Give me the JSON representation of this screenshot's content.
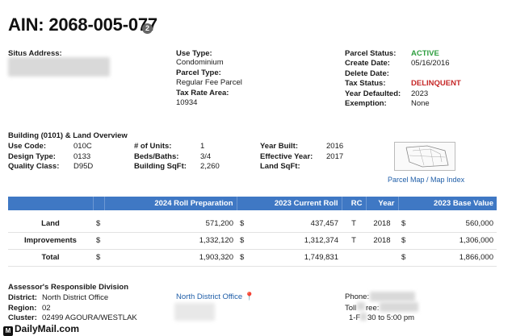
{
  "header": {
    "title": "AIN: 2068-005-077",
    "badge": "2"
  },
  "situs": {
    "label": "Situs Address:"
  },
  "use": {
    "use_type_label": "Use Type:",
    "use_type_value": "Condominium",
    "parcel_type_label": "Parcel Type:",
    "parcel_type_value": "Regular Fee Parcel",
    "tax_rate_label": "Tax Rate Area:",
    "tax_rate_value": "10934"
  },
  "status": {
    "parcel_status_label": "Parcel Status:",
    "parcel_status_value": "ACTIVE",
    "create_date_label": "Create Date:",
    "create_date_value": "05/16/2016",
    "delete_date_label": "Delete Date:",
    "delete_date_value": "",
    "tax_status_label": "Tax Status:",
    "tax_status_value": "DELINQUENT",
    "year_defaulted_label": "Year Defaulted:",
    "year_defaulted_value": "2023",
    "exemption_label": "Exemption:",
    "exemption_value": "None"
  },
  "building": {
    "heading": "Building (0101) & Land Overview",
    "use_code_label": "Use Code:",
    "use_code_value": "010C",
    "design_type_label": "Design Type:",
    "design_type_value": "0133",
    "quality_class_label": "Quality Class:",
    "quality_class_value": "D95D",
    "units_label": "# of Units:",
    "units_value": "1",
    "beds_baths_label": "Beds/Baths:",
    "beds_baths_value": "3/4",
    "building_sqft_label": "Building SqFt:",
    "building_sqft_value": "2,260",
    "year_built_label": "Year Built:",
    "year_built_value": "2016",
    "effective_year_label": "Effective Year:",
    "effective_year_value": "2017",
    "land_sqft_label": "Land SqFt:",
    "land_sqft_value": "",
    "parcel_map_link": "Parcel Map",
    "separator": " / ",
    "index_map_link": "Map Index"
  },
  "roll_table": {
    "headers": [
      "",
      "",
      "2024 Roll Preparation",
      "2023 Current Roll",
      "RC",
      "Year",
      "2023 Base Value"
    ],
    "rows": [
      {
        "label": "Land",
        "cur1": "$",
        "prep": "571,200",
        "cur2": "$",
        "current": "437,457",
        "rc": "T",
        "year": "2018",
        "cur3": "$",
        "base": "560,000"
      },
      {
        "label": "Improvements",
        "cur1": "$",
        "prep": "1,332,120",
        "cur2": "$",
        "current": "1,312,374",
        "rc": "T",
        "year": "2018",
        "cur3": "$",
        "base": "1,306,000"
      },
      {
        "label": "Total",
        "cur1": "$",
        "prep": "1,903,320",
        "cur2": "$",
        "current": "1,749,831",
        "rc": "",
        "year": "",
        "cur3": "$",
        "base": "1,866,000"
      }
    ]
  },
  "division": {
    "heading": "Assessor's Responsible Division",
    "district_label": "District:",
    "district_value": "North District Office",
    "region_label": "Region:",
    "region_value": "02",
    "cluster_label": "Cluster:",
    "cluster_value": "02499 AGOURA/WESTLAK",
    "office_link": "North District Office",
    "phone_label": "Phone:",
    "toll_free_label": "Toll",
    "toll_free_label2": "ree:",
    "hours_text": "1-F",
    "hours_text2": "30 to 5:00 pm"
  },
  "watermark": {
    "text": "DailyMail.com",
    "icon": "M"
  },
  "icons": {
    "pin": "location-pin-icon"
  }
}
